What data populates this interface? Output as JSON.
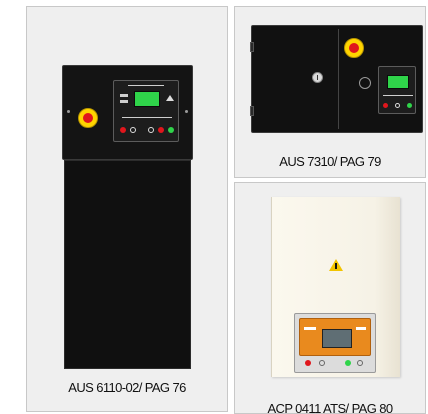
{
  "products": [
    {
      "caption": "AUS 6110-02/ PAG 76"
    },
    {
      "caption": "AUS 7310/ PAG 79"
    },
    {
      "caption": "ACP 0411 ATS/ PAG 80"
    }
  ],
  "colors": {
    "card_bg": "#efefef",
    "card_border": "#c8c8c8",
    "enclosure": "#111111",
    "lcd_green": "#2fd44a",
    "estop_yellow": "#ffd400",
    "estop_red": "#e0161c",
    "ats_orange": "#e98a1e",
    "warning_yellow": "#f2c400"
  }
}
